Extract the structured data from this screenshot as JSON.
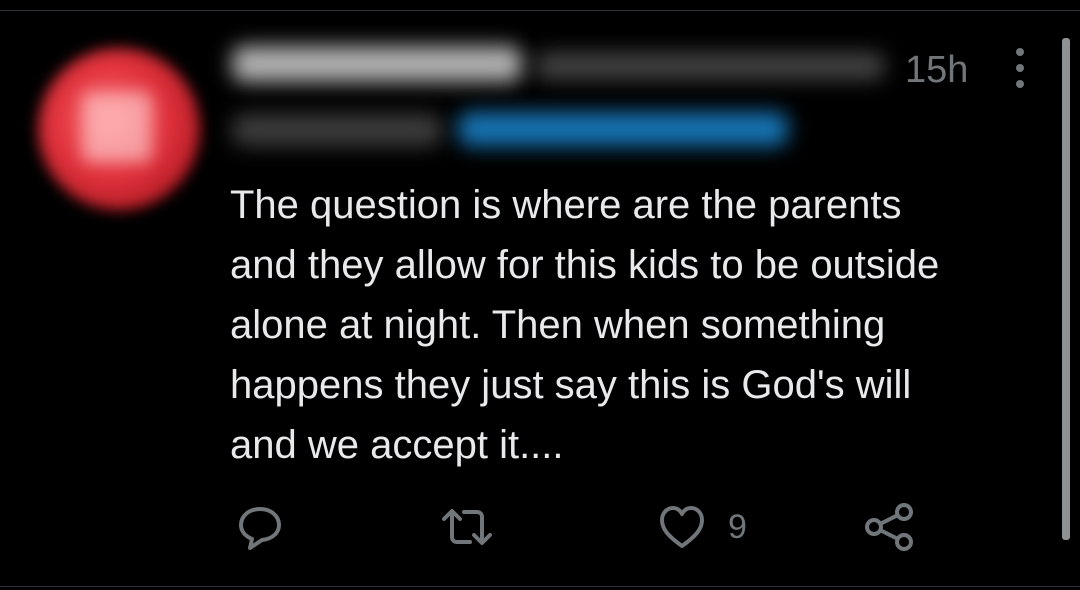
{
  "tweet": {
    "timestamp": "15h",
    "text": "The question is where are the parents\nand they allow for this kids to be outside\nalone at night. Then when something\nhappens they just say this is God's will\nand we accept it....",
    "like_count": "9"
  },
  "icons": {
    "more": "more-vertical-icon",
    "reply": "reply-icon",
    "retweet": "retweet-icon",
    "like": "heart-icon",
    "share": "share-icon"
  },
  "colors": {
    "background": "#000000",
    "text": "#e7e9ea",
    "muted": "#71767b",
    "mention_blue": "#1d9bf0",
    "avatar_red": "#e0323c"
  }
}
